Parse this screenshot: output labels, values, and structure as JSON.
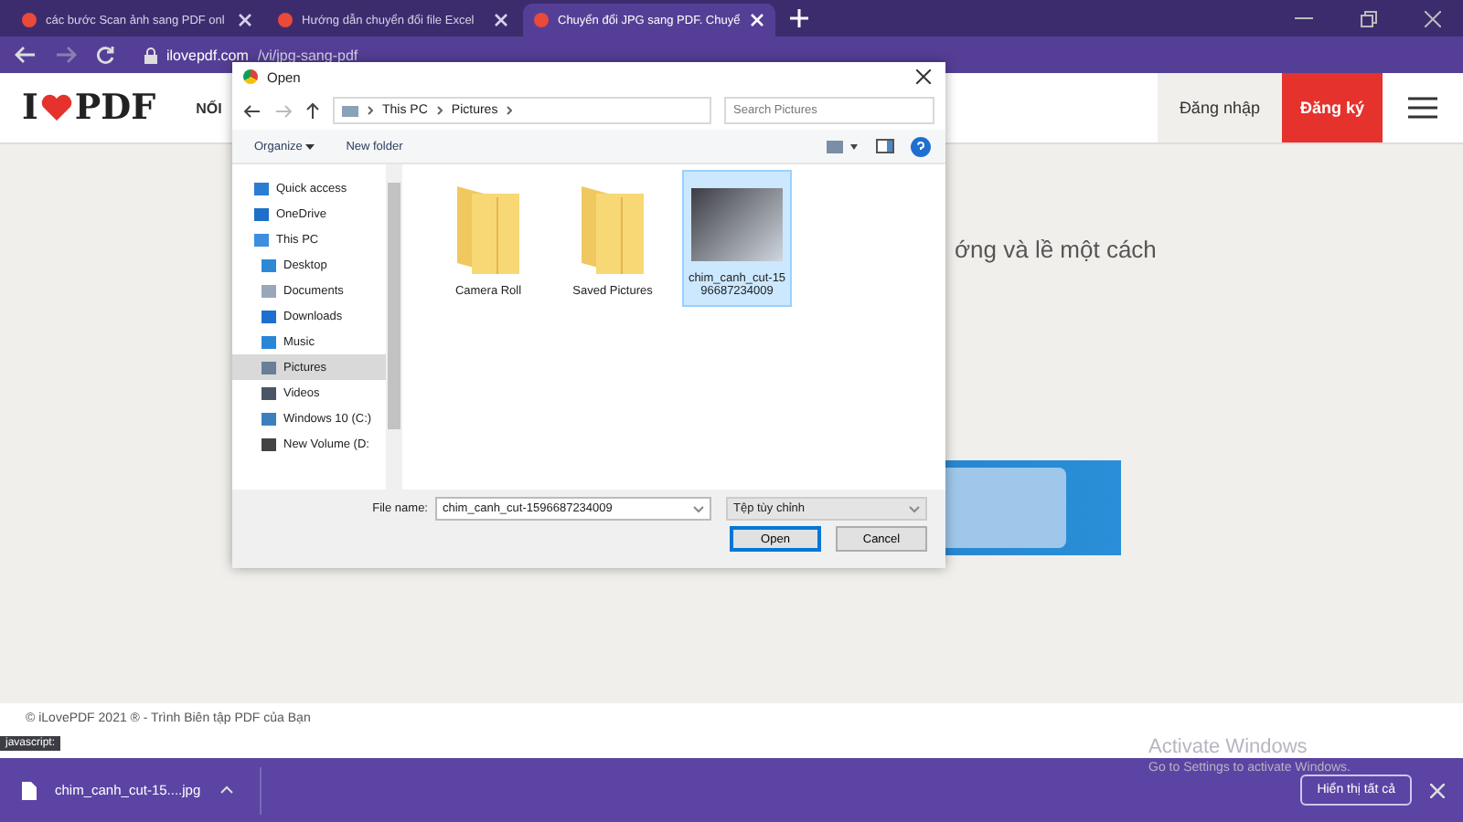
{
  "browser": {
    "tabs": [
      {
        "title": "các bước Scan ảnh sang PDF onl",
        "selected": false
      },
      {
        "title": "Hướng dẫn chuyển đổi file Excel",
        "selected": false
      },
      {
        "title": "Chuyển đổi JPG sang PDF. Chuyể",
        "selected": true
      }
    ],
    "address": {
      "host": "ilovepdf.com",
      "path": "/vi/jpg-sang-pdf"
    }
  },
  "site": {
    "logo_left": "I",
    "logo_right": "PDF",
    "nav_item": "NỐI",
    "login": "Đăng nhập",
    "signup": "Đăng ký",
    "headline": "ớng và lề một cách",
    "footer": "© iLovePDF 2021 ® - Trình Biên tập PDF của Bạn"
  },
  "dialog": {
    "title": "Open",
    "breadcrumb": [
      "This PC",
      "Pictures"
    ],
    "search": {
      "placeholder": "Search Pictures"
    },
    "toolbar": [
      "Organize",
      "New folder"
    ],
    "sidebar": [
      {
        "label": "Quick access",
        "kind": "star",
        "selected": false
      },
      {
        "label": "OneDrive",
        "kind": "cloud",
        "selected": false
      },
      {
        "label": "This PC",
        "kind": "pc",
        "selected": false,
        "children": [
          {
            "label": "Desktop",
            "kind": "desktop",
            "selected": false
          },
          {
            "label": "Documents",
            "kind": "doc",
            "selected": false
          },
          {
            "label": "Downloads",
            "kind": "download",
            "selected": false
          },
          {
            "label": "Music",
            "kind": "music",
            "selected": false
          },
          {
            "label": "Pictures",
            "kind": "pictures",
            "selected": true
          },
          {
            "label": "Videos",
            "kind": "video",
            "selected": false
          },
          {
            "label": "Windows 10 (C:)",
            "kind": "drive",
            "selected": false
          },
          {
            "label": "New Volume (D:",
            "kind": "drive2",
            "selected": false
          }
        ]
      }
    ],
    "files": [
      {
        "name": "Camera Roll",
        "kind": "folder",
        "selected": false
      },
      {
        "name": "Saved Pictures",
        "kind": "folder",
        "selected": false
      },
      {
        "name": "chim_canh_cut-1596687234009",
        "kind": "photo",
        "selected": true
      }
    ],
    "file_name_label": "File name:",
    "file_name": "chim_canh_cut-1596687234009",
    "file_type": "Tệp tùy chỉnh",
    "open": "Open",
    "cancel": "Cancel"
  },
  "tooltip": "javascript:",
  "download_bar": {
    "file": "chim_canh_cut-15....jpg",
    "show_all": "Hiển thị tất cả"
  },
  "os_notice": {
    "title": "Activate Windows",
    "text": "Go to Settings to activate Windows."
  }
}
